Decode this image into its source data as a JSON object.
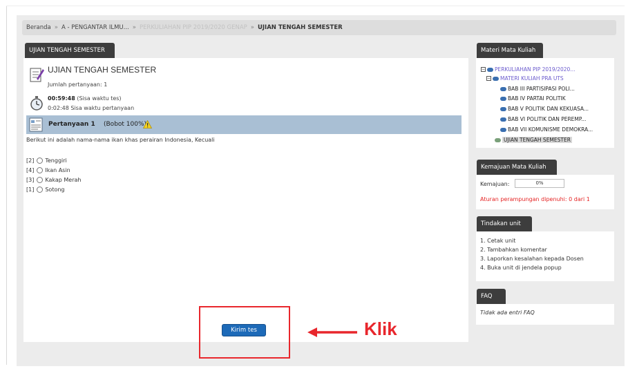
{
  "breadcrumb": {
    "items": [
      "Beranda",
      "A - PENGANTAR ILMU...",
      "PERKULIAHAN PIP 2019/2020 GENAP",
      "UJIAN TENGAH SEMESTER"
    ],
    "separator": "»"
  },
  "main": {
    "tab_label": "UJIAN TENGAH SEMESTER",
    "quiz_title": "UJIAN TENGAH SEMESTER",
    "question_count": "Jumlah pertanyaan: 1",
    "timer_value": "00:59:48",
    "timer_label": "(Sisa waktu tes)",
    "question_timer": "0:02:48 Sisa waktu pertanyaan",
    "question_label": "Pertanyaan 1",
    "question_weight": "(Bobot 100%)",
    "question_text": "Berikut ini adalah nama-nama ikan khas perairan Indonesia, Kecuali",
    "options": [
      {
        "code": "[2]",
        "label": "Tenggiri"
      },
      {
        "code": "[4]",
        "label": "Ikan Asin"
      },
      {
        "code": "[3]",
        "label": "Kakap Merah"
      },
      {
        "code": "[1]",
        "label": "Sotong"
      }
    ],
    "submit_label": "Kirim tes"
  },
  "annotation": {
    "label": "Klik",
    "color": "#e8262c"
  },
  "sidebar": {
    "materials": {
      "title": "Materi Mata Kuliah",
      "items": [
        "PERKULIAHAN PIP 2019/2020...",
        "MATERI KULIAH PRA UTS",
        "BAB III PARTISIPASI POLI...",
        "BAB IV PARTAI POLITIK",
        "BAB V POLITIK DAN KEKUASA...",
        "BAB VI POLITIK DAN PEREMP...",
        "BAB VII KOMUNISME DEMOKRA...",
        "UJIAN TENGAH SEMESTER"
      ]
    },
    "progress": {
      "title": "Kemajuan Mata Kuliah",
      "label": "Kemajuan:",
      "value": "0%",
      "rule": "Aturan perampungan dipenuhi: 0 dari 1"
    },
    "unit_actions": {
      "title": "Tindakan unit",
      "items": [
        "1. Cetak unit",
        "2. Tambahkan komentar",
        "3. Laporkan kesalahan kepada Dosen",
        "4. Buka unit di jendela popup"
      ]
    },
    "faq": {
      "title": "FAQ",
      "empty": "Tidak ada entri FAQ"
    }
  },
  "colors": {
    "tab_bg": "#3d3d3d",
    "question_bar": "#a9bfd4",
    "button": "#1d6ab8",
    "alert": "#e52222"
  }
}
